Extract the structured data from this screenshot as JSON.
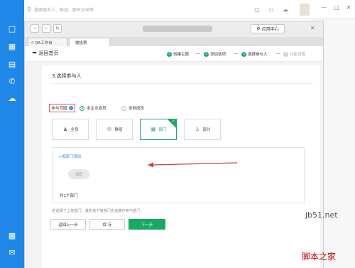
{
  "topbar": {
    "search_placeholder": "搜索联系人、群组、聊天记录等"
  },
  "browser": {
    "app_center": "应用中心",
    "tabs": [
      "OA工作台",
      "微投票"
    ]
  },
  "header": {
    "back": "返回首页",
    "steps": [
      {
        "num": "1",
        "label": "创建主题",
        "done": true
      },
      {
        "num": "2",
        "label": "添加选项",
        "done": true
      },
      {
        "num": "3",
        "label": "选择参与人",
        "done": true
      },
      {
        "num": "4",
        "label": "功能设置",
        "done": false
      }
    ]
  },
  "main": {
    "section_title": "3.选择参与人",
    "scope_label": "参与范围",
    "scope_options": [
      "本企业成员",
      "全网成员"
    ],
    "selected_scope": "本企业成员",
    "member_types": [
      {
        "label": "全员",
        "icon": "users-icon"
      },
      {
        "label": "群组",
        "icon": "group-chat-icon"
      },
      {
        "label": "部门",
        "icon": "department-icon"
      },
      {
        "label": "部分",
        "icon": "person-icon"
      }
    ],
    "selected_member_type": "部门",
    "add_dept": "+按部门添加",
    "dept_count": "共1个部门",
    "hint": "若选择了上级部门，其所有下级部门也会算作参与部门",
    "buttons": {
      "prev": "返回上一步",
      "save": "保 存",
      "next": "下一步"
    }
  },
  "watermark": {
    "site": "jb51.net",
    "brand": "脚本之家"
  },
  "colors": {
    "sidebar": "#1e87e8",
    "accent_green": "#1aa867",
    "highlight_red": "#e05a5a",
    "link_blue": "#2b8be8"
  }
}
